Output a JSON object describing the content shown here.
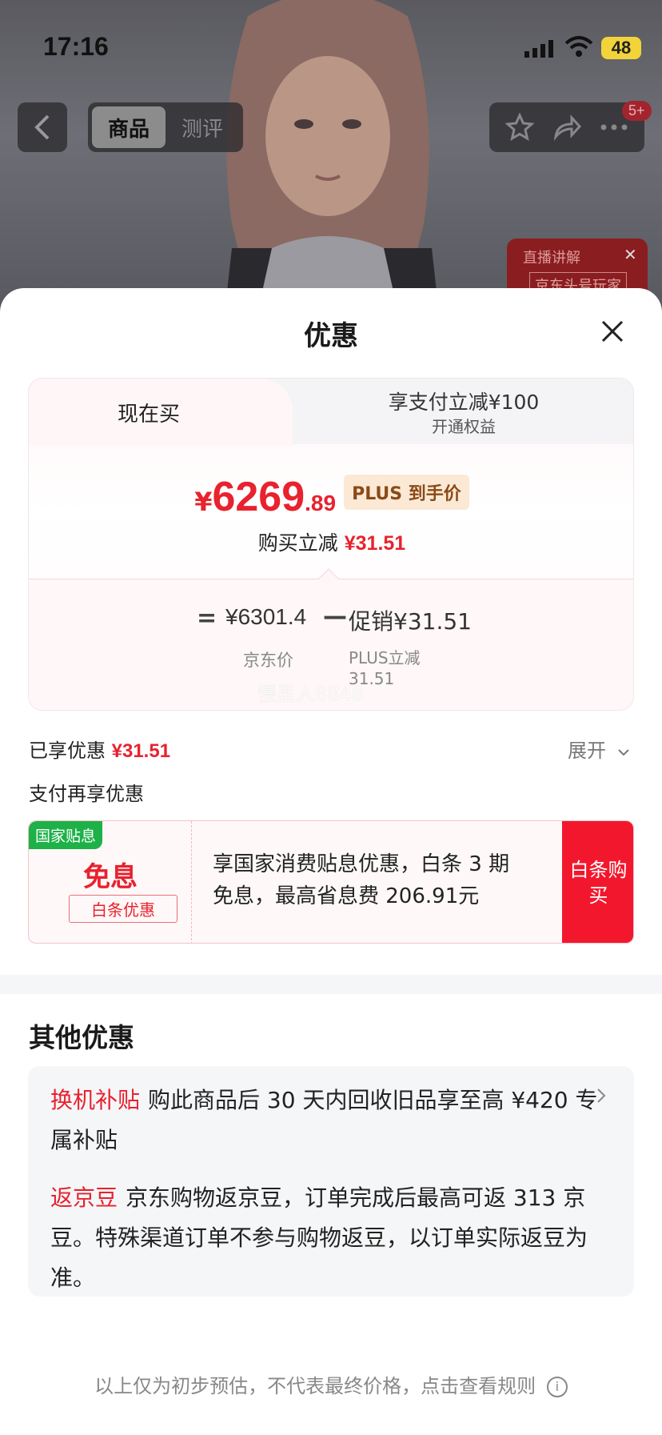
{
  "status_bar": {
    "time": "17:16",
    "battery": "48"
  },
  "nav": {
    "tabs": [
      {
        "label": "商品",
        "active": true
      },
      {
        "label": "测评",
        "active": false
      }
    ],
    "badge": "5+"
  },
  "live_popup": {
    "title": "直播讲解",
    "banner": "京东头号玩家"
  },
  "sheet": {
    "title": "优惠",
    "tabs": {
      "left": "现在买",
      "right_line1": "享支付立减¥100",
      "right_line2": "开通权益"
    },
    "price": {
      "currency": "¥",
      "integer": "6269",
      "decimal": ".89",
      "tag": "PLUS 到手价"
    },
    "purchase_reduce": {
      "label": "购买立减",
      "amount": "¥31.51"
    },
    "calc": {
      "equals": "=",
      "jd_price": "¥6301.4",
      "minus": "—",
      "promo": "促销¥31.51",
      "jd_price_label": "京东价",
      "plus_label_line1": "PLUS立减",
      "plus_label_line2": "31.51"
    },
    "watermark": "慢星人8848",
    "enjoyed": {
      "label": "已享优惠",
      "amount": "¥31.51"
    },
    "expand_label": "展开",
    "pay_again": "支付再享优惠",
    "installment": {
      "flag": "国家贴息",
      "headline": "免息",
      "sublabel": "白条优惠",
      "text": "享国家消费贴息优惠，白条 3 期免息，最高省息费 206.91元",
      "button": "白条购买"
    },
    "other": {
      "title": "其他优惠",
      "items": [
        {
          "tag": "换机补贴",
          "text": "购此商品后 30 天内回收旧品享至高 ¥420 专属补贴"
        },
        {
          "tag": "返京豆",
          "text": "京东购物返京豆，订单完成后最高可返 313 京豆。特殊渠道订单不参与购物返豆，以订单实际返豆为准。"
        }
      ]
    },
    "footnote": "以上仅为初步预估，不代表最终价格，点击查看规则",
    "info_glyph": "i"
  },
  "colors": {
    "accent_red": "#e8222e",
    "green_flag": "#1db148",
    "plus_tag_bg": "#fbe9d6"
  }
}
